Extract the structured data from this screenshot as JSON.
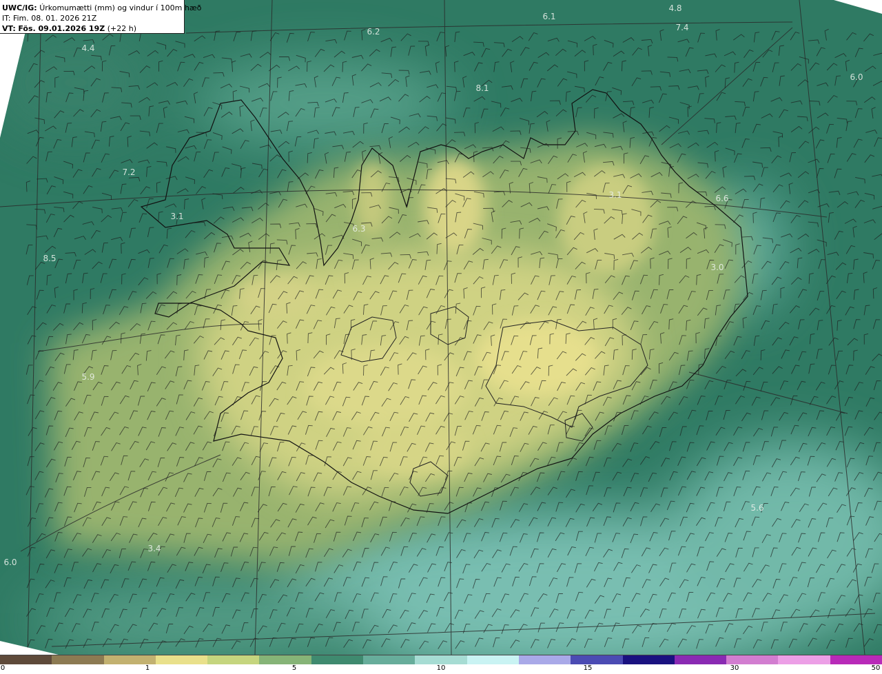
{
  "header": {
    "model": "UWC/IG:",
    "description": "Úrkomumætti (mm) og vindur í 100m hæð",
    "it_label": "IT: Fim. 08. 01. 2026 21Z",
    "vt_prefix": "VT:",
    "vt_time": "Fös. 09.01.2026 19Z",
    "vt_suffix": "(+22 h)"
  },
  "map_labels": [
    {
      "id": "l1",
      "text": "6.1"
    },
    {
      "id": "l2",
      "text": "4.8"
    },
    {
      "id": "l3",
      "text": "7.4"
    },
    {
      "id": "l4",
      "text": "6.2"
    },
    {
      "id": "l5",
      "text": "4.4"
    },
    {
      "id": "l6",
      "text": "6.0"
    },
    {
      "id": "l7",
      "text": "8.1"
    },
    {
      "id": "l8",
      "text": "7.2"
    },
    {
      "id": "l9",
      "text": "3.1"
    },
    {
      "id": "l10",
      "text": "6.3"
    },
    {
      "id": "l11",
      "text": "3.1"
    },
    {
      "id": "l12",
      "text": "6.6"
    },
    {
      "id": "l13",
      "text": "3.0"
    },
    {
      "id": "l14",
      "text": "8.5"
    },
    {
      "id": "l15",
      "text": "5.9"
    },
    {
      "id": "l16",
      "text": "5.6"
    },
    {
      "id": "l17",
      "text": "3.4"
    },
    {
      "id": "l18",
      "text": "6.0"
    }
  ],
  "colorbar": {
    "ticks": [
      "0",
      "1",
      "5",
      "10",
      "15",
      "30",
      "50"
    ],
    "colors": [
      "#5e4a3a",
      "#8c7a52",
      "#c2b170",
      "#e9e08b",
      "#c5d57e",
      "#86b477",
      "#3f8a6f",
      "#67ad9b",
      "#a6dcd3",
      "#c9f3f3",
      "#a9a9e8",
      "#4b4bb3",
      "#1a1180",
      "#8a2ab3",
      "#d27dd0",
      "#ec9fe6",
      "#b82ab8"
    ]
  },
  "colors": {
    "land_high": "#e3dc8a",
    "land_mid": "#a8bd72",
    "sea_dark": "#2c7561",
    "sea_light": "#8fd0c8",
    "background": "#ffffff"
  }
}
